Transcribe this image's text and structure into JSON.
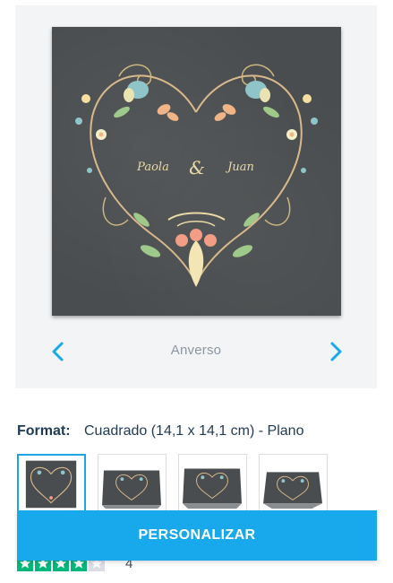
{
  "preview": {
    "card_text": {
      "name_left": "Paola",
      "ampersand": "&",
      "name_right": "Juan"
    },
    "side_label": "Anverso",
    "prev_icon": "chevron-left-icon",
    "next_icon": "chevron-right-icon"
  },
  "format": {
    "label": "Format:",
    "value": "Cuadrado (14,1 x 14,1 cm) - Plano"
  },
  "thumbnails": [
    {
      "name": "flat-card",
      "selected": true
    },
    {
      "name": "folded-card-1",
      "selected": false
    },
    {
      "name": "folded-card-2",
      "selected": false
    },
    {
      "name": "folded-card-3",
      "selected": false
    }
  ],
  "cta": {
    "label": "PERSONALIZAR"
  },
  "rating": {
    "stars_filled": 4,
    "stars_total": 5,
    "value": "4"
  },
  "colors": {
    "accent": "#18a9ec",
    "star_green": "#00b67a",
    "star_grey": "#dcdce6",
    "chalkboard": "#4a4d4f",
    "gold": "#e9d9a6"
  }
}
